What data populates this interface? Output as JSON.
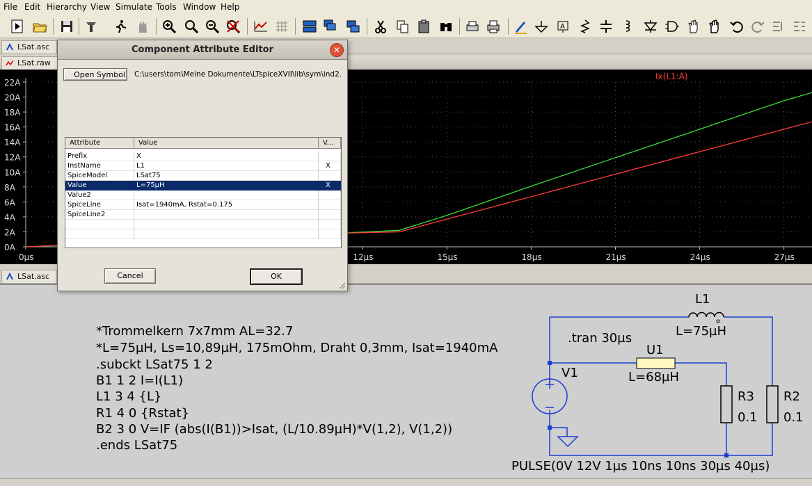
{
  "menu": [
    "File",
    "Edit",
    "Hierarchy",
    "View",
    "Simulate",
    "Tools",
    "Window",
    "Help"
  ],
  "tabs": {
    "schematic_top": "LSat.asc",
    "plot": "LSat.raw",
    "schematic_bottom": "LSat.asc"
  },
  "plot": {
    "trace_label": "Ix(L1:A)",
    "trace_color": "#ff3b3b",
    "trace2_color": "#39e039",
    "y_ticks": [
      "22A",
      "20A",
      "18A",
      "16A",
      "14A",
      "12A",
      "10A",
      "8A",
      "6A",
      "4A",
      "2A",
      "0A"
    ],
    "x_ticks": [
      "0µs",
      "12µs",
      "15µs",
      "18µs",
      "21µs",
      "24µs",
      "27µs"
    ]
  },
  "chart_data": {
    "type": "line",
    "title": "",
    "xlabel": "",
    "ylabel": "",
    "xlim": [
      0,
      28
    ],
    "ylim": [
      0,
      22
    ],
    "series": [
      {
        "name": "Ix(L1:A)",
        "x": [
          0,
          11,
          13.3,
          15,
          18,
          21,
          24,
          27,
          28
        ],
        "y": [
          0,
          1.8,
          2.0,
          3.7,
          6.7,
          9.7,
          12.7,
          15.7,
          16.7
        ]
      },
      {
        "x": [
          0,
          11,
          13.3,
          15,
          18,
          21,
          24,
          27,
          28
        ],
        "y": [
          0,
          1.8,
          2.2,
          4.2,
          8.1,
          11.9,
          15.7,
          19.5,
          20.6
        ]
      }
    ]
  },
  "dialog": {
    "title": "Component Attribute Editor",
    "open_symbol_label": "Open Symbol",
    "symbol_path": "C:\\users\\tom\\Meine Dokumente\\LTspiceXVII\\lib\\sym\\ind2.",
    "columns": [
      "Attribute",
      "Value",
      "V..."
    ],
    "rows": [
      {
        "attr": "Prefix",
        "value": "X",
        "vis": ""
      },
      {
        "attr": "InstName",
        "value": "L1",
        "vis": "X"
      },
      {
        "attr": "SpiceModel",
        "value": "LSat75",
        "vis": ""
      },
      {
        "attr": "Value",
        "value": "L=75µH",
        "vis": "X"
      },
      {
        "attr": "Value2",
        "value": "",
        "vis": ""
      },
      {
        "attr": "SpiceLine",
        "value": "Isat=1940mA, Rstat=0.175",
        "vis": ""
      },
      {
        "attr": "SpiceLine2",
        "value": "",
        "vis": ""
      }
    ],
    "selected_row": 3,
    "cancel_label": "Cancel",
    "ok_label": "OK"
  },
  "schematic": {
    "netlist": [
      "*Trommelkern 7x7mm AL=32.7",
      "*L=75µH, Ls=10,89µH, 175mOhm, Draht 0,3mm, Isat=1940mA",
      ".subckt LSat75 1 2",
      "B1 1 2 I=I(L1)",
      "L1 3 4 {L}",
      "R1 4 0 {Rstat}",
      "B2 3 0 V=IF (abs(I(B1))>Isat, (L/10.89µH)*V(1,2), V(1,2))",
      ".ends LSat75"
    ],
    "tran": ".tran 30µs",
    "l1_name": "L1",
    "l1_value": "L=75µH",
    "u1_name": "U1",
    "u1_value": "L=68µH",
    "v1_name": "V1",
    "r3_name": "R3",
    "r3_value": "0.1",
    "r2_name": "R2",
    "r2_value": "0.1",
    "pulse": "PULSE(0V 12V 1µs 10ns 10ns 30µs 40µs)"
  }
}
